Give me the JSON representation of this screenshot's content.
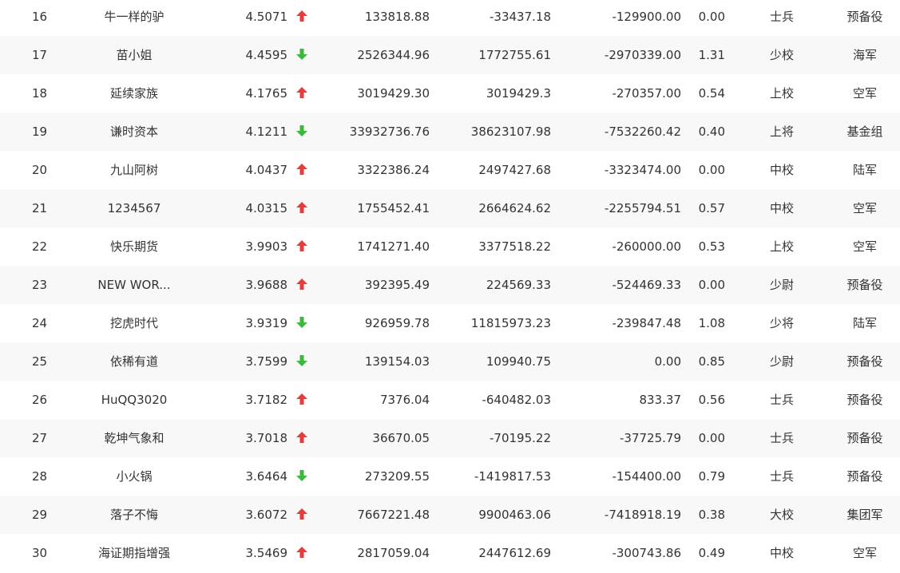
{
  "colors": {
    "up": "#e63c3c",
    "down": "#3cb83c",
    "text": "#333333",
    "alt_row": "#f8f8f8"
  },
  "icons": {
    "up": "arrow-up-icon",
    "down": "arrow-down-icon"
  },
  "rows": [
    {
      "rank": "16",
      "name": "牛一样的驴",
      "score": "4.5071",
      "trend": "up",
      "v1": "133818.88",
      "v2": "-33437.18",
      "v3": "-129900.00",
      "ratio": "0.00",
      "title": "士兵",
      "group": "预备役"
    },
    {
      "rank": "17",
      "name": "苗小姐",
      "score": "4.4595",
      "trend": "down",
      "v1": "2526344.96",
      "v2": "1772755.61",
      "v3": "-2970339.00",
      "ratio": "1.31",
      "title": "少校",
      "group": "海军"
    },
    {
      "rank": "18",
      "name": "延续家族",
      "score": "4.1765",
      "trend": "up",
      "v1": "3019429.30",
      "v2": "3019429.3",
      "v3": "-270357.00",
      "ratio": "0.54",
      "title": "上校",
      "group": "空军"
    },
    {
      "rank": "19",
      "name": "谦时资本",
      "score": "4.1211",
      "trend": "down",
      "v1": "33932736.76",
      "v2": "38623107.98",
      "v3": "-7532260.42",
      "ratio": "0.40",
      "title": "上将",
      "group": "基金组"
    },
    {
      "rank": "20",
      "name": "九山阿树",
      "score": "4.0437",
      "trend": "up",
      "v1": "3322386.24",
      "v2": "2497427.68",
      "v3": "-3323474.00",
      "ratio": "0.00",
      "title": "中校",
      "group": "陆军"
    },
    {
      "rank": "21",
      "name": "1234567",
      "score": "4.0315",
      "trend": "up",
      "v1": "1755452.41",
      "v2": "2664624.62",
      "v3": "-2255794.51",
      "ratio": "0.57",
      "title": "中校",
      "group": "空军"
    },
    {
      "rank": "22",
      "name": "快乐期货",
      "score": "3.9903",
      "trend": "up",
      "v1": "1741271.40",
      "v2": "3377518.22",
      "v3": "-260000.00",
      "ratio": "0.53",
      "title": "上校",
      "group": "空军"
    },
    {
      "rank": "23",
      "name": "NEW WOR...",
      "score": "3.9688",
      "trend": "up",
      "v1": "392395.49",
      "v2": "224569.33",
      "v3": "-524469.33",
      "ratio": "0.00",
      "title": "少尉",
      "group": "预备役"
    },
    {
      "rank": "24",
      "name": "挖虎时代",
      "score": "3.9319",
      "trend": "down",
      "v1": "926959.78",
      "v2": "11815973.23",
      "v3": "-239847.48",
      "ratio": "1.08",
      "title": "少将",
      "group": "陆军"
    },
    {
      "rank": "25",
      "name": "依稀有道",
      "score": "3.7599",
      "trend": "down",
      "v1": "139154.03",
      "v2": "109940.75",
      "v3": "0.00",
      "ratio": "0.85",
      "title": "少尉",
      "group": "预备役"
    },
    {
      "rank": "26",
      "name": "HuQQ3020",
      "score": "3.7182",
      "trend": "up",
      "v1": "7376.04",
      "v2": "-640482.03",
      "v3": "833.37",
      "ratio": "0.56",
      "title": "士兵",
      "group": "预备役"
    },
    {
      "rank": "27",
      "name": "乾坤气象和",
      "score": "3.7018",
      "trend": "up",
      "v1": "36670.05",
      "v2": "-70195.22",
      "v3": "-37725.79",
      "ratio": "0.00",
      "title": "士兵",
      "group": "预备役"
    },
    {
      "rank": "28",
      "name": "小火锅",
      "score": "3.6464",
      "trend": "down",
      "v1": "273209.55",
      "v2": "-1419817.53",
      "v3": "-154400.00",
      "ratio": "0.79",
      "title": "士兵",
      "group": "预备役"
    },
    {
      "rank": "29",
      "name": "落子不悔",
      "score": "3.6072",
      "trend": "up",
      "v1": "7667221.48",
      "v2": "9900463.06",
      "v3": "-7418918.19",
      "ratio": "0.38",
      "title": "大校",
      "group": "集团军"
    },
    {
      "rank": "30",
      "name": "海证期指增强",
      "score": "3.5469",
      "trend": "up",
      "v1": "2817059.04",
      "v2": "2447612.69",
      "v3": "-300743.86",
      "ratio": "0.49",
      "title": "中校",
      "group": "空军"
    }
  ]
}
